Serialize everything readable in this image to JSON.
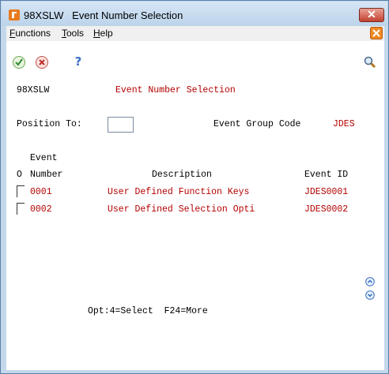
{
  "window": {
    "title": "98XSLW   Event Number Selection",
    "close_label": "✕"
  },
  "menu": {
    "functions": {
      "first": "F",
      "rest": "unctions"
    },
    "tools": {
      "first": "T",
      "rest": "ools"
    },
    "help": {
      "first": "H",
      "rest": "elp"
    }
  },
  "header": {
    "program_id": "98XSLW",
    "screen_title": "Event Number Selection"
  },
  "filters": {
    "position_to_label": "Position To:",
    "position_to_value": "",
    "event_group_code_label": "Event Group Code",
    "event_group_code_value": "JDES"
  },
  "table": {
    "col_option": "O",
    "col_event_line1": "Event",
    "col_event_line2": "Number",
    "col_description": "Description",
    "col_event_id": "Event ID",
    "rows": [
      {
        "number": "0001",
        "description": "User Defined Function Keys",
        "event_id": "JDES0001"
      },
      {
        "number": "0002",
        "description": "User Defined Selection Opti",
        "event_id": "JDES0002"
      }
    ]
  },
  "footer": {
    "options_text": "Opt:4=Select  F24=More"
  },
  "colors": {
    "accent_red": "#b40000",
    "window_frame": "#c4d8ec"
  },
  "icons": [
    "app-icon",
    "close-icon",
    "jde-menu-icon",
    "ok-check-icon",
    "cancel-x-icon",
    "help-question-icon",
    "search-magnifier-icon",
    "scroll-up-icon",
    "scroll-down-icon"
  ]
}
